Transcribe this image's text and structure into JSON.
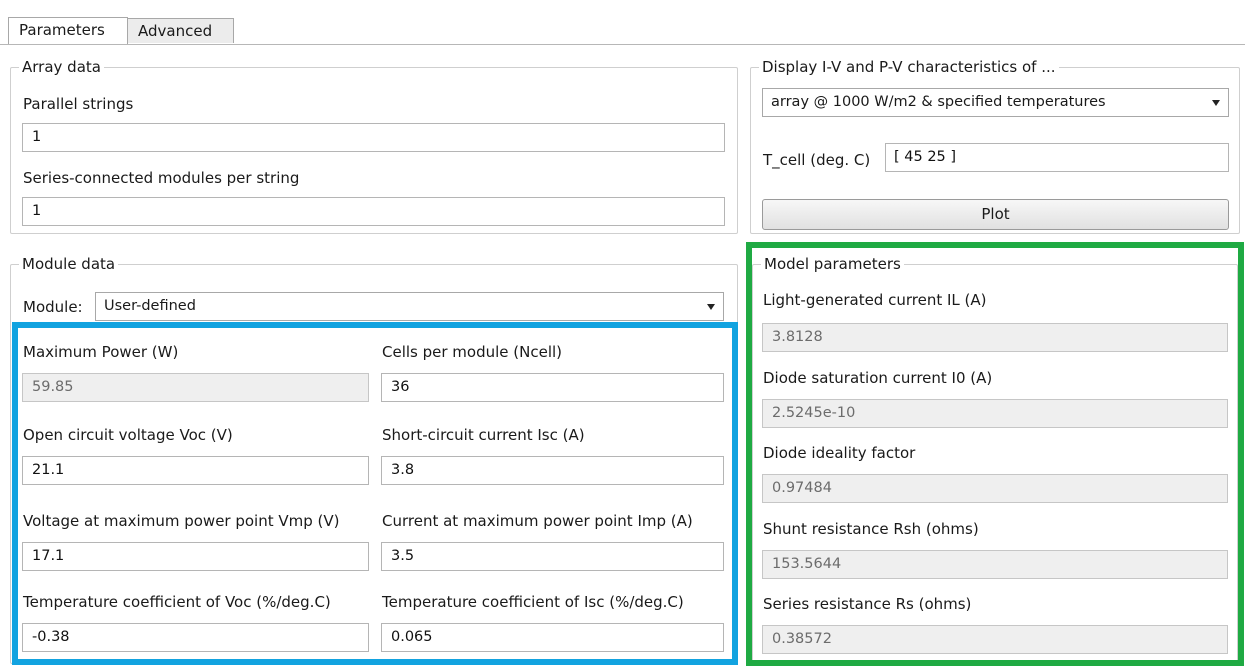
{
  "tabs": [
    "Parameters",
    "Advanced"
  ],
  "array_data": {
    "title": "Array data",
    "parallel_strings_label": "Parallel strings",
    "parallel_strings_value": "1",
    "series_modules_label": "Series-connected modules per string",
    "series_modules_value": "1"
  },
  "display": {
    "title": "Display  I-V and P-V characteristics of ...",
    "select_value": "array @ 1000 W/m2 & specified temperatures",
    "tcell_label": "T_cell (deg. C)",
    "tcell_value": "[ 45 25 ]",
    "plot_label": "Plot"
  },
  "module_data": {
    "title": "Module data",
    "module_label": "Module:",
    "module_value": "User-defined",
    "max_power_label": "Maximum Power (W)",
    "max_power_value": "59.85",
    "cells_label": "Cells per module (Ncell)",
    "cells_value": "36",
    "voc_label": "Open circuit voltage  Voc (V)",
    "voc_value": "21.1",
    "isc_label": "Short-circuit current Isc (A)",
    "isc_value": "3.8",
    "vmp_label": "Voltage at maximum power point Vmp (V)",
    "vmp_value": "17.1",
    "imp_label": "Current at maximum power point Imp (A)",
    "imp_value": "3.5",
    "tcvoc_label": "Temperature coefficient of Voc (%/deg.C)",
    "tcvoc_value": "-0.38",
    "tcisc_label": "Temperature coefficient of Isc (%/deg.C)",
    "tcisc_value": "0.065"
  },
  "model_params": {
    "title": "Model parameters",
    "il_label": "Light-generated current IL (A)",
    "il_value": "3.8128",
    "i0_label": "Diode saturation current I0 (A)",
    "i0_value": "2.5245e-10",
    "ideality_label": "Diode ideality factor",
    "ideality_value": "0.97484",
    "rsh_label": "Shunt resistance Rsh (ohms)",
    "rsh_value": "153.5644",
    "rs_label": "Series resistance Rs (ohms)",
    "rs_value": "0.38572"
  },
  "highlight_colors": {
    "module_box": "#12a3e0",
    "model_box": "#1faa43"
  }
}
